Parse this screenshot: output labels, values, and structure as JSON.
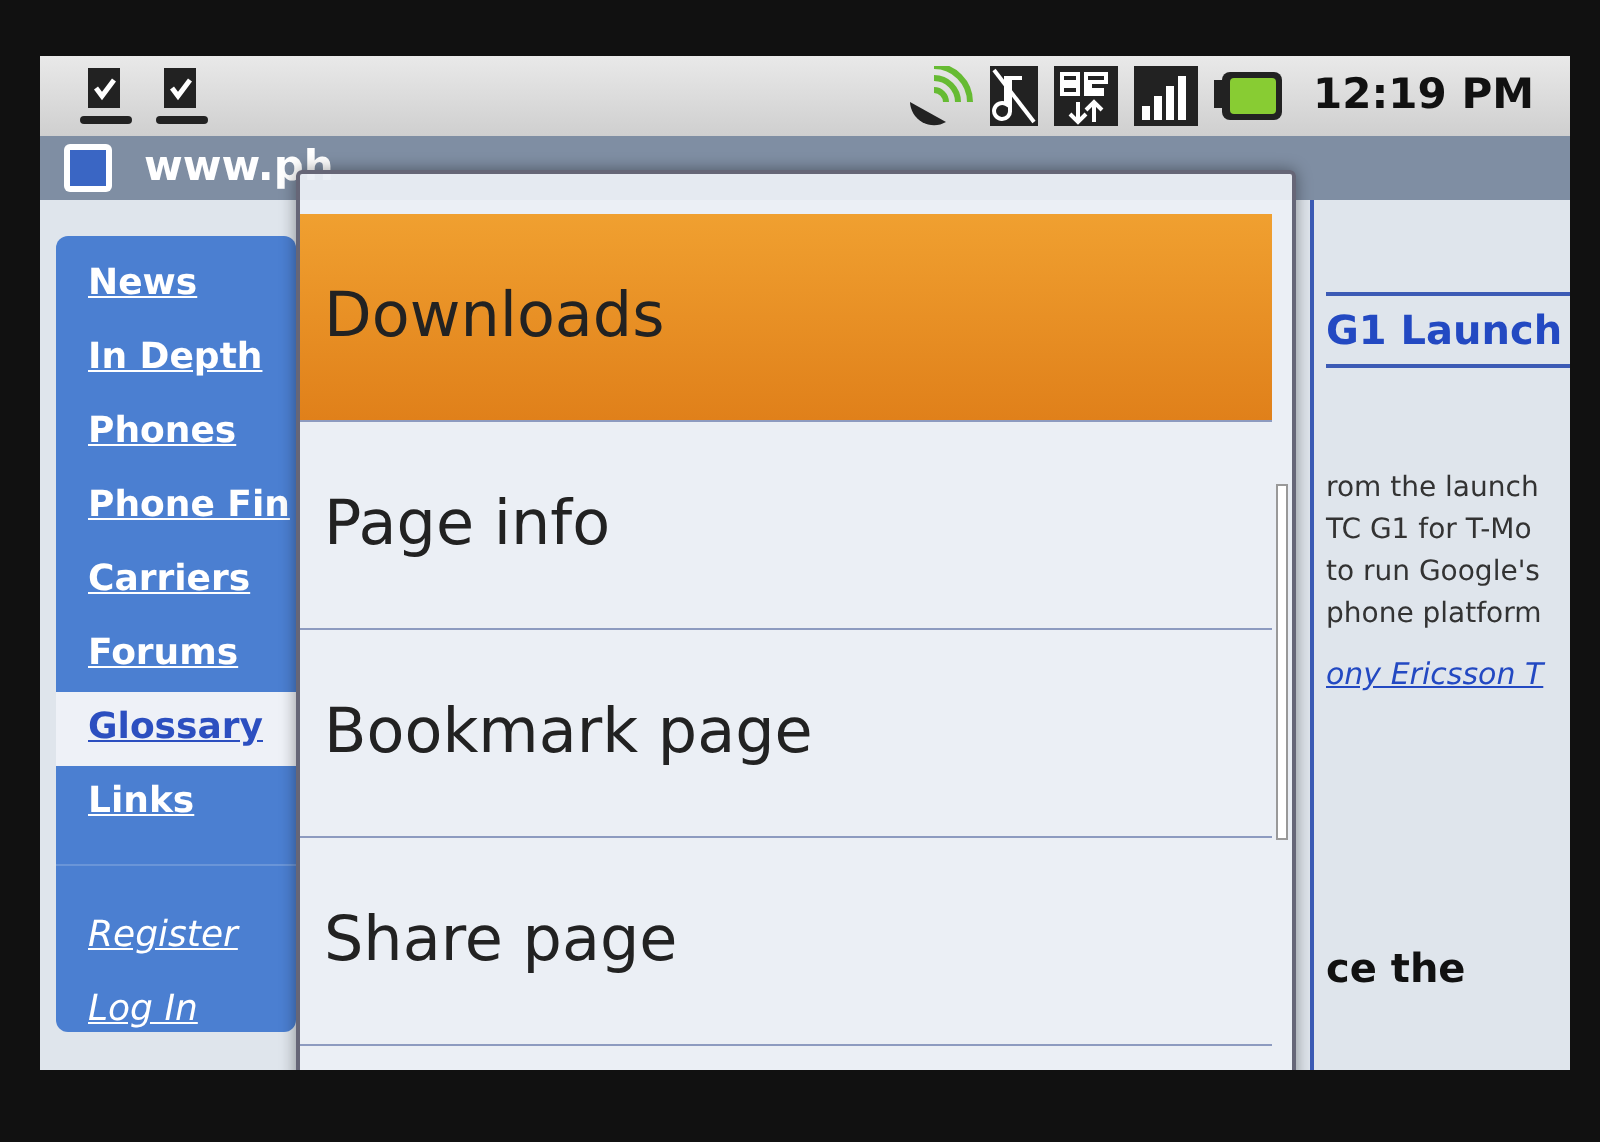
{
  "status_bar": {
    "time": "12:19 PM"
  },
  "address_bar": {
    "text": "www.ph"
  },
  "sidebar": {
    "items": [
      {
        "label": "News",
        "kind": "nav",
        "selected": false
      },
      {
        "label": "In Depth",
        "kind": "nav",
        "selected": false
      },
      {
        "label": "Phones",
        "kind": "nav",
        "selected": false
      },
      {
        "label": "Phone Fin",
        "kind": "nav",
        "selected": false
      },
      {
        "label": "Carriers",
        "kind": "nav",
        "selected": false
      },
      {
        "label": "Forums",
        "kind": "nav",
        "selected": false
      },
      {
        "label": "Glossary",
        "kind": "nav",
        "selected": true
      },
      {
        "label": "Links",
        "kind": "nav",
        "selected": false
      },
      {
        "label": "Register",
        "kind": "account",
        "selected": false
      },
      {
        "label": "Log In",
        "kind": "account",
        "selected": false
      }
    ]
  },
  "menu": {
    "items": [
      {
        "label": "Downloads",
        "selected": true
      },
      {
        "label": "Page info",
        "selected": false
      },
      {
        "label": "Bookmark page",
        "selected": false
      },
      {
        "label": "Share page",
        "selected": false
      }
    ]
  },
  "page": {
    "headline": "G1 Launch",
    "lines": [
      "rom the launch",
      "TC G1 for T-Mo",
      "to run Google's",
      "phone platform"
    ],
    "review_link": "ony Ericsson T",
    "headline_tail": "ce the"
  }
}
